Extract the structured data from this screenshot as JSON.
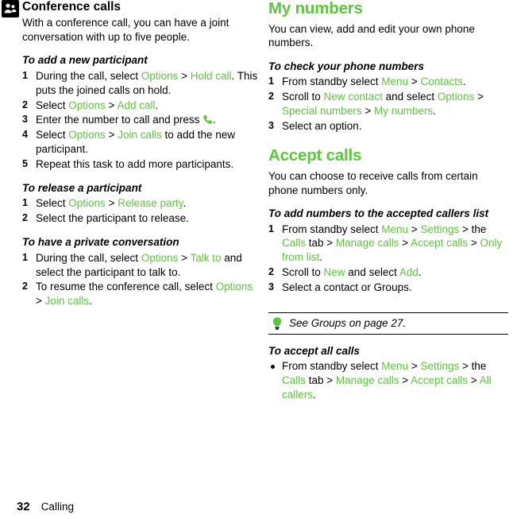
{
  "document": {
    "footer": {
      "page_number": "32",
      "chapter": "Calling"
    }
  },
  "left_column": {
    "icon": "conference-call-icon",
    "section_title": "Conference calls",
    "intro": "With a conference call, you can have a joint conversation with up to five people.",
    "sub1": {
      "title": "To add a new participant",
      "steps": [
        {
          "parts": [
            {
              "t": "During the call, select ",
              "c": "black"
            },
            {
              "t": "Options",
              "c": "green"
            },
            {
              "t": " > ",
              "c": "black"
            },
            {
              "t": "Hold call",
              "c": "green"
            },
            {
              "t": ". This puts the joined calls on hold.",
              "c": "black"
            }
          ]
        },
        {
          "parts": [
            {
              "t": "Select ",
              "c": "black"
            },
            {
              "t": "Options",
              "c": "green"
            },
            {
              "t": " > ",
              "c": "black"
            },
            {
              "t": "Add call",
              "c": "green"
            },
            {
              "t": ".",
              "c": "black"
            }
          ]
        },
        {
          "parts": [
            {
              "t": "Enter the number to call and press ",
              "c": "black"
            },
            {
              "t": "[call-handset-icon]",
              "c": "icon"
            },
            {
              "t": ".",
              "c": "black"
            }
          ]
        },
        {
          "parts": [
            {
              "t": "Select ",
              "c": "black"
            },
            {
              "t": "Options",
              "c": "green"
            },
            {
              "t": " > ",
              "c": "black"
            },
            {
              "t": "Join calls",
              "c": "green"
            },
            {
              "t": " to add the new participant.",
              "c": "black"
            }
          ]
        },
        {
          "parts": [
            {
              "t": "Repeat this task to add more participants.",
              "c": "black"
            }
          ]
        }
      ]
    },
    "sub2": {
      "title": "To release a participant",
      "steps": [
        {
          "parts": [
            {
              "t": "Select ",
              "c": "black"
            },
            {
              "t": "Options",
              "c": "green"
            },
            {
              "t": " > ",
              "c": "black"
            },
            {
              "t": "Release party",
              "c": "green"
            },
            {
              "t": ".",
              "c": "black"
            }
          ]
        },
        {
          "parts": [
            {
              "t": "Select the participant to release.",
              "c": "black"
            }
          ]
        }
      ]
    },
    "sub3": {
      "title": "To have a private conversation",
      "steps": [
        {
          "parts": [
            {
              "t": "During the call, select ",
              "c": "black"
            },
            {
              "t": "Options",
              "c": "green"
            },
            {
              "t": " > ",
              "c": "black"
            },
            {
              "t": "Talk to",
              "c": "green"
            },
            {
              "t": " and select the participant to talk to.",
              "c": "black"
            }
          ]
        },
        {
          "parts": [
            {
              "t": "To resume the conference call, select ",
              "c": "black"
            },
            {
              "t": "Options",
              "c": "green"
            },
            {
              "t": " > ",
              "c": "black"
            },
            {
              "t": "Join calls",
              "c": "green"
            },
            {
              "t": ".",
              "c": "black"
            }
          ]
        }
      ]
    }
  },
  "right_column": {
    "title1": "My numbers",
    "intro1": "You can view, add and edit your own phone numbers.",
    "sub1": {
      "title": "To check your phone numbers",
      "steps": [
        {
          "parts": [
            {
              "t": "From standby select ",
              "c": "black"
            },
            {
              "t": "Menu",
              "c": "green"
            },
            {
              "t": " > ",
              "c": "black"
            },
            {
              "t": "Contacts",
              "c": "green"
            },
            {
              "t": ".",
              "c": "black"
            }
          ]
        },
        {
          "parts": [
            {
              "t": "Scroll to ",
              "c": "black"
            },
            {
              "t": "New contact",
              "c": "green"
            },
            {
              "t": " and select ",
              "c": "black"
            },
            {
              "t": "Options",
              "c": "green"
            },
            {
              "t": " > ",
              "c": "black"
            },
            {
              "t": "Special numbers",
              "c": "green"
            },
            {
              "t": " > ",
              "c": "black"
            },
            {
              "t": "My numbers",
              "c": "green"
            },
            {
              "t": ".",
              "c": "black"
            }
          ]
        },
        {
          "parts": [
            {
              "t": "Select an option.",
              "c": "black"
            }
          ]
        }
      ]
    },
    "title2": "Accept calls",
    "intro2": "You can choose to receive calls from certain phone numbers only.",
    "sub2": {
      "title": "To add numbers to the accepted callers list",
      "steps": [
        {
          "parts": [
            {
              "t": "From standby select ",
              "c": "black"
            },
            {
              "t": "Menu",
              "c": "green"
            },
            {
              "t": " > ",
              "c": "black"
            },
            {
              "t": "Settings",
              "c": "green"
            },
            {
              "t": " > the ",
              "c": "black"
            },
            {
              "t": "Calls",
              "c": "green"
            },
            {
              "t": " tab > ",
              "c": "black"
            },
            {
              "t": "Manage calls",
              "c": "green"
            },
            {
              "t": " > ",
              "c": "black"
            },
            {
              "t": "Accept calls",
              "c": "green"
            },
            {
              "t": " > ",
              "c": "black"
            },
            {
              "t": "Only from list",
              "c": "green"
            },
            {
              "t": ".",
              "c": "black"
            }
          ]
        },
        {
          "parts": [
            {
              "t": "Scroll to ",
              "c": "black"
            },
            {
              "t": "New",
              "c": "green"
            },
            {
              "t": " and select ",
              "c": "black"
            },
            {
              "t": "Add",
              "c": "green"
            },
            {
              "t": ".",
              "c": "black"
            }
          ]
        },
        {
          "parts": [
            {
              "t": "Select a contact or Groups.",
              "c": "black"
            }
          ]
        }
      ]
    },
    "tip": "See Groups on page 27.",
    "sub3": {
      "title": "To accept all calls",
      "bullets": [
        {
          "parts": [
            {
              "t": "From standby select ",
              "c": "black"
            },
            {
              "t": "Menu",
              "c": "green"
            },
            {
              "t": " > ",
              "c": "black"
            },
            {
              "t": "Settings",
              "c": "green"
            },
            {
              "t": " > the ",
              "c": "black"
            },
            {
              "t": "Calls",
              "c": "green"
            },
            {
              "t": " tab > ",
              "c": "black"
            },
            {
              "t": "Manage calls",
              "c": "green"
            },
            {
              "t": " > ",
              "c": "black"
            },
            {
              "t": "Accept calls",
              "c": "green"
            },
            {
              "t": " > ",
              "c": "black"
            },
            {
              "t": "All callers",
              "c": "green"
            },
            {
              "t": ".",
              "c": "black"
            }
          ]
        }
      ]
    }
  },
  "colors": {
    "accent_green": "#5cc63c",
    "text": "#000000"
  }
}
